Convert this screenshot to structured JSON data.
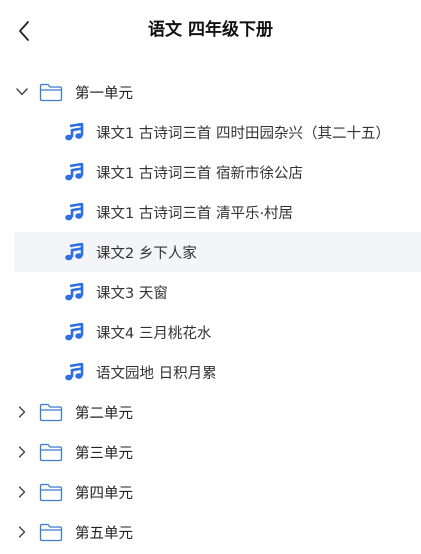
{
  "header": {
    "title": "语文 四年级下册"
  },
  "units": [
    {
      "label": "第一单元",
      "expanded": true,
      "lessons": [
        {
          "label": "课文1 古诗词三首 四时田园杂兴（其二十五）"
        },
        {
          "label": "课文1 古诗词三首 宿新市徐公店"
        },
        {
          "label": "课文1 古诗词三首 清平乐·村居"
        },
        {
          "label": "课文2 乡下人家",
          "selected": true
        },
        {
          "label": "课文3 天窗"
        },
        {
          "label": "课文4 三月桃花水"
        },
        {
          "label": "语文园地 日积月累"
        }
      ]
    },
    {
      "label": "第二单元",
      "expanded": false
    },
    {
      "label": "第三单元",
      "expanded": false
    },
    {
      "label": "第四单元",
      "expanded": false
    },
    {
      "label": "第五单元",
      "expanded": false
    }
  ],
  "colors": {
    "accent": "#2f6fe4",
    "folder_stroke": "#3a7bd5",
    "selected_bg": "#f4f5f8"
  }
}
